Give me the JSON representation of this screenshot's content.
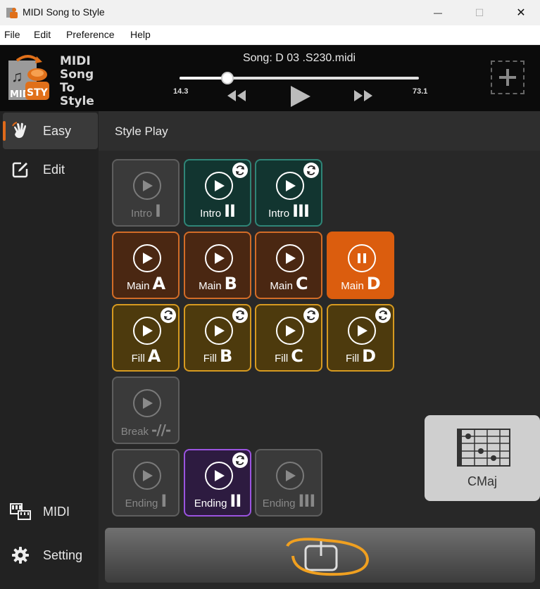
{
  "window": {
    "title": "MIDI Song to Style",
    "minimize": "—",
    "maximize": "☐",
    "close": "✕"
  },
  "menu": [
    "File",
    "Edit",
    "Preference",
    "Help"
  ],
  "logo": {
    "lines": [
      "MIDI",
      "Song",
      "To",
      "Style"
    ],
    "badge": "STY",
    "mid": "MID"
  },
  "player": {
    "song": "Song: D  03 .S230.midi",
    "time_left": "14.3",
    "time_right": "73.1",
    "position_fraction": 0.2
  },
  "sidebar": {
    "items": [
      {
        "label": "Easy",
        "icon": "hand-icon",
        "active": true
      },
      {
        "label": "Edit",
        "icon": "edit-icon",
        "active": false
      },
      {
        "label": "MIDI",
        "icon": "keyboard-icon",
        "active": false
      },
      {
        "label": "Setting",
        "icon": "gear-icon",
        "active": false
      }
    ]
  },
  "main": {
    "title": "Style Play"
  },
  "pads": {
    "intro1": {
      "name": "Intro",
      "num": "I"
    },
    "intro2": {
      "name": "Intro",
      "num": "II"
    },
    "intro3": {
      "name": "Intro",
      "num": "III"
    },
    "mainA": {
      "name": "Main",
      "num": "A"
    },
    "mainB": {
      "name": "Main",
      "num": "B"
    },
    "mainC": {
      "name": "Main",
      "num": "C"
    },
    "mainD": {
      "name": "Main",
      "num": "D"
    },
    "fillA": {
      "name": "Fill",
      "num": "A"
    },
    "fillB": {
      "name": "Fill",
      "num": "B"
    },
    "fillC": {
      "name": "Fill",
      "num": "C"
    },
    "fillD": {
      "name": "Fill",
      "num": "D"
    },
    "break": {
      "name": "Break",
      "num": "-//-"
    },
    "ending1": {
      "name": "Ending",
      "num": "I"
    },
    "ending2": {
      "name": "Ending",
      "num": "II"
    },
    "ending3": {
      "name": "Ending",
      "num": "III"
    }
  },
  "chord": {
    "name": "CMaj"
  },
  "colors": {
    "accent": "#db5d0e",
    "annotation": "#f0a020"
  }
}
